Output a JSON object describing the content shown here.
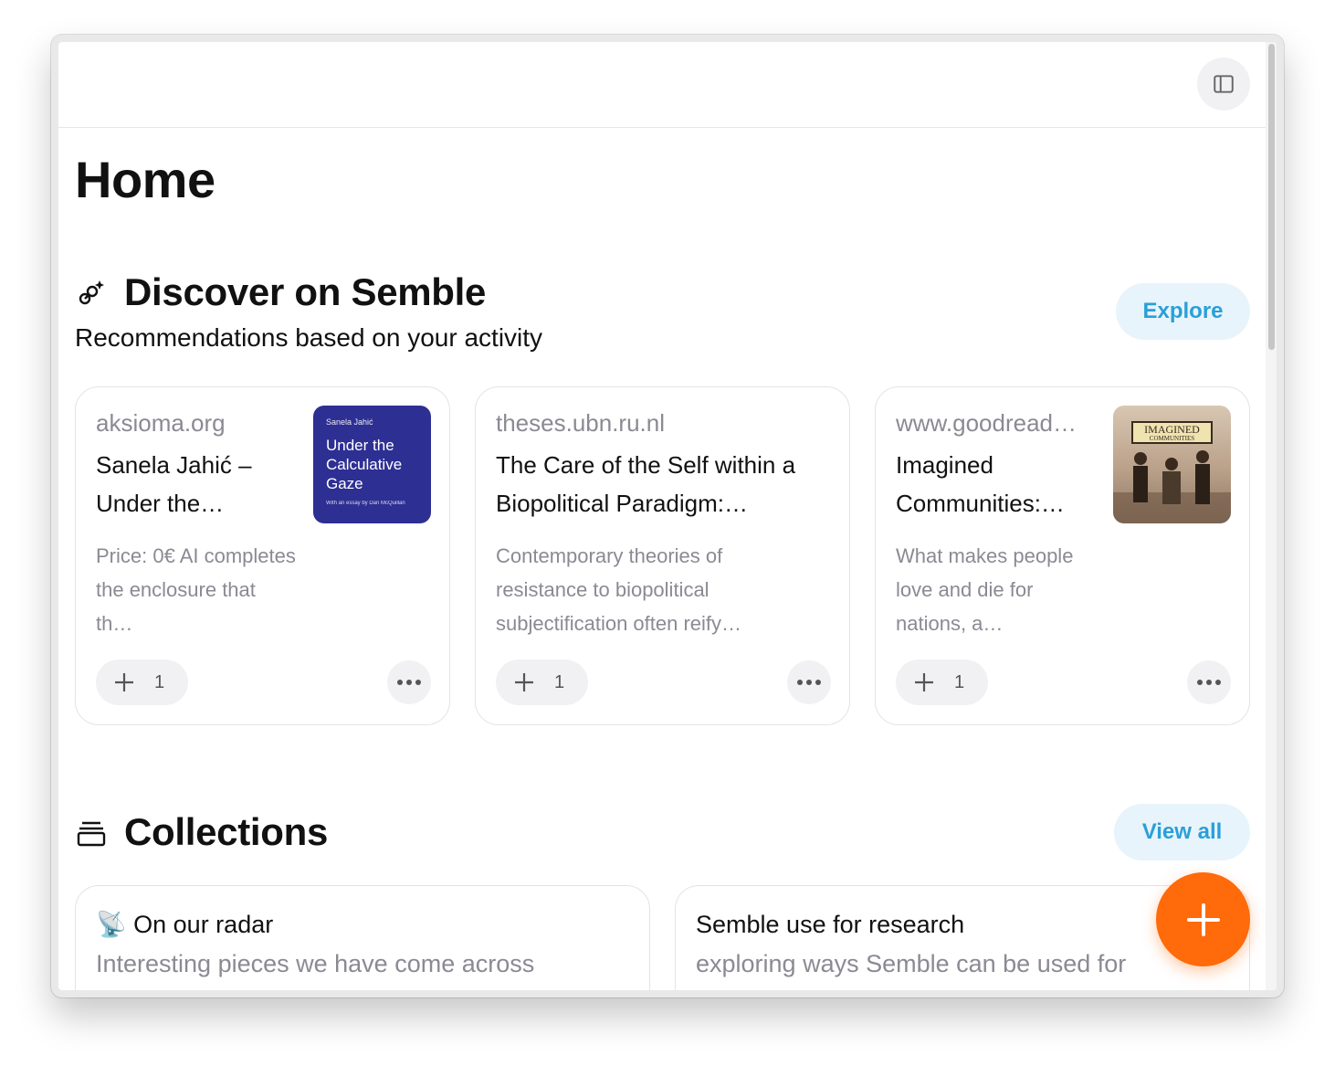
{
  "page": {
    "title": "Home"
  },
  "discover": {
    "heading": "Discover on Semble",
    "subtitle": "Recommendations based on your activity",
    "explore_label": "Explore",
    "cards": [
      {
        "domain": "aksioma.org",
        "title": "Sanela Jahić – Under the…",
        "description": "Price: 0€ AI completes the enclosure that th…",
        "count": "1",
        "thumbnail": {
          "author": "Sanela Jahić",
          "book_title": "Under the Calculative Gaze",
          "essay": "With an essay by Dan McQuillan"
        }
      },
      {
        "domain": "theses.ubn.ru.nl",
        "title": "The Care of the Self within a Biopolitical Paradigm:…",
        "description": "Contemporary theories of resistance to biopolitical subjectification often reify…",
        "count": "1"
      },
      {
        "domain": "www.goodread…",
        "title": "Imagined Communities:…",
        "description": "What makes people love and die for nations, a…",
        "count": "1",
        "thumbnail": {
          "line1": "IMAGINED",
          "line2": "COMMUNITIES"
        }
      }
    ]
  },
  "collections": {
    "heading": "Collections",
    "view_all_label": "View all",
    "items": [
      {
        "emoji": "📡",
        "title": "On our radar",
        "description": "Interesting pieces we have come across"
      },
      {
        "title": "Semble use for research",
        "description": "exploring ways Semble can be used for"
      }
    ]
  },
  "colors": {
    "accent_blue": "#2a9fd8",
    "fab_orange": "#ff6a0a",
    "muted_text": "#8a8a93"
  }
}
